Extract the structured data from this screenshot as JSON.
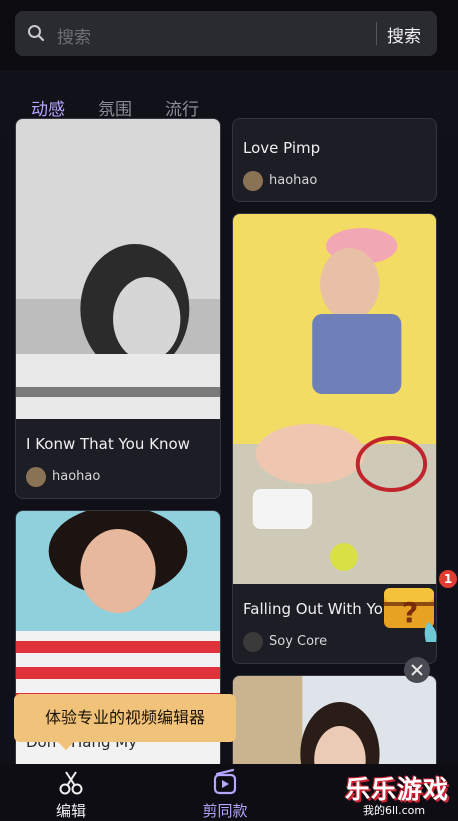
{
  "search": {
    "placeholder": "搜索",
    "button_label": "搜索"
  },
  "tabs": [
    {
      "label": "动感",
      "active": true
    },
    {
      "label": "氛围",
      "active": false
    },
    {
      "label": "流行",
      "active": false
    }
  ],
  "cards": [
    {
      "title": "Love Pimp",
      "user": "haohao"
    },
    {
      "title": "I Konw That You Know",
      "user": "haohao"
    },
    {
      "title": "Falling Out With Yo",
      "user": "Soy Core"
    },
    {
      "title": "Don't Hang My"
    }
  ],
  "tooltip": {
    "text": "体验专业的视频编辑器"
  },
  "bottom_nav": [
    {
      "label": "编辑",
      "icon": "scissors-icon"
    },
    {
      "label": "剪同款",
      "icon": "template-icon",
      "active": true
    }
  ],
  "promo": {
    "badge_count": "1",
    "icon": "treasure-chest-icon"
  },
  "watermark": {
    "text": "乐乐游戏",
    "sub": "我的6ll.com"
  },
  "colors": {
    "accent": "#b7a6ff",
    "tooltip": "#f1c27a",
    "background": "#0f1018",
    "card": "#1c1d25"
  }
}
